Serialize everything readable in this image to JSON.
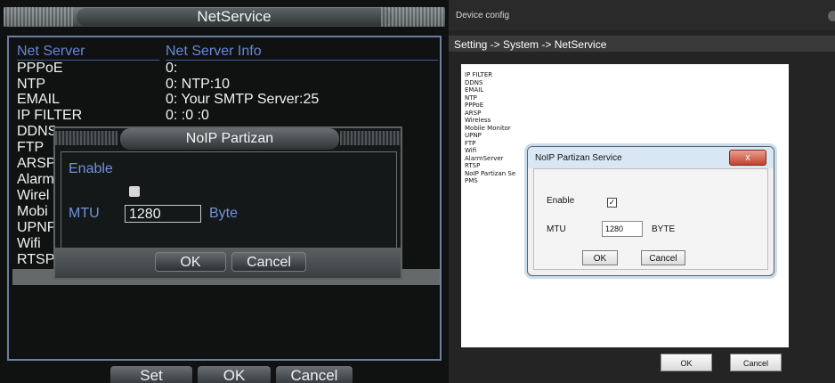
{
  "left": {
    "title": "NetService",
    "headers": {
      "col1": "Net Server",
      "col2": "Net Server Info"
    },
    "rows": [
      {
        "name": "PPPoE",
        "info": "0:"
      },
      {
        "name": "NTP",
        "info": "0: NTP:10"
      },
      {
        "name": "EMAIL",
        "info": "0: Your SMTP Server:25"
      },
      {
        "name": "IP FILTER",
        "info": "0: :0 :0"
      },
      {
        "name": "DDNS",
        "info": ""
      },
      {
        "name": "FTP",
        "info": ""
      },
      {
        "name": "ARSP",
        "info": ""
      },
      {
        "name": "Alarm",
        "info": ""
      },
      {
        "name": "Wirel",
        "info": ""
      },
      {
        "name": "Mobi",
        "info": ""
      },
      {
        "name": "UPNP",
        "info": ""
      },
      {
        "name": "Wifi",
        "info": ""
      },
      {
        "name": "RTSP",
        "info": ""
      }
    ],
    "dialog": {
      "title": "NoIP Partizan",
      "enable_label": "Enable",
      "mtu_label": "MTU",
      "mtu_value": "1280",
      "unit": "Byte",
      "ok": "OK",
      "cancel": "Cancel"
    },
    "buttons": {
      "set": "Set",
      "ok": "OK",
      "cancel": "Cancel"
    }
  },
  "right": {
    "window_title": "Device config",
    "breadcrumb": "Setting -> System -> NetService",
    "list": [
      "IP FILTER",
      "DDNS",
      "EMAIL",
      "NTP",
      "PPPoE",
      "ARSP",
      "Wireless",
      "Mobile Monitor",
      "UPNP",
      "FTP",
      "Wifi",
      "AlarmServer",
      "RTSP",
      "NoIP Partizan Se",
      "PMS"
    ],
    "dialog": {
      "title": "NoIP Partizan Service",
      "close": "x",
      "enable_label": "Enable",
      "enable_checked": true,
      "mtu_label": "MTU",
      "mtu_value": "1280",
      "unit": "BYTE",
      "ok": "OK",
      "cancel": "Cancel"
    },
    "buttons": {
      "ok": "OK",
      "cancel": "Cancel"
    }
  }
}
